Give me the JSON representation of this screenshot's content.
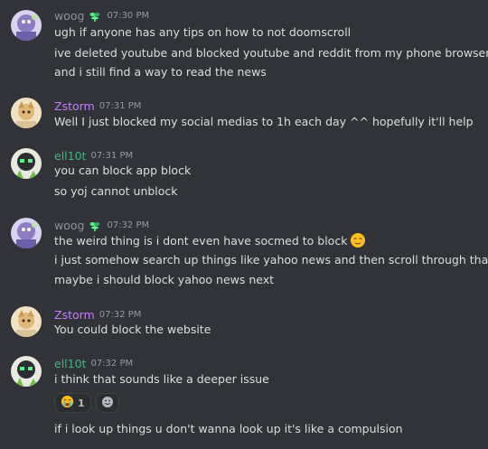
{
  "theme": {
    "background": "#313338",
    "text": "#dbdee1",
    "timestamp": "#949ba4"
  },
  "users": {
    "woog": {
      "name": "woog",
      "color": "#8e9297",
      "badge": "plant-icon"
    },
    "zstorm": {
      "name": "Zstorm",
      "color": "#c77dff"
    },
    "ell10t": {
      "name": "ell10t",
      "color": "#43b581"
    }
  },
  "messages": [
    {
      "author": "woog",
      "time": "07:30 PM",
      "lines": [
        "ugh if anyone has any tips on how to not doomscroll",
        "ive deleted youtube and blocked youtube and reddit from my phone browser",
        "and i still find a way to read the news"
      ]
    },
    {
      "author": "Zstorm",
      "time": "07:31 PM",
      "lines": [
        "Well I just blocked my social medias to 1h each day ^^ hopefully it'll help"
      ]
    },
    {
      "author": "ell10t",
      "time": "07:31 PM",
      "lines": [
        "you can block app block",
        "so yoj cannot unblock"
      ]
    },
    {
      "author": "woog",
      "time": "07:32 PM",
      "lines": [
        "the weird thing is i dont even have socmed to block",
        "i just somehow search up things like yahoo news and then scroll through that",
        "maybe i should block yahoo news next"
      ],
      "inline_emoji": "relieved-face-icon"
    },
    {
      "author": "Zstorm",
      "time": "07:32 PM",
      "lines": [
        "You could block the website"
      ]
    },
    {
      "author": "ell10t",
      "time": "07:32 PM",
      "lines": [
        "i think that sounds like a deeper issue"
      ],
      "reactions": [
        {
          "emoji": "crying-face-icon",
          "count": "1"
        }
      ],
      "followup": "if i look up things u don't wanna look up it's like a compulsion"
    }
  ]
}
